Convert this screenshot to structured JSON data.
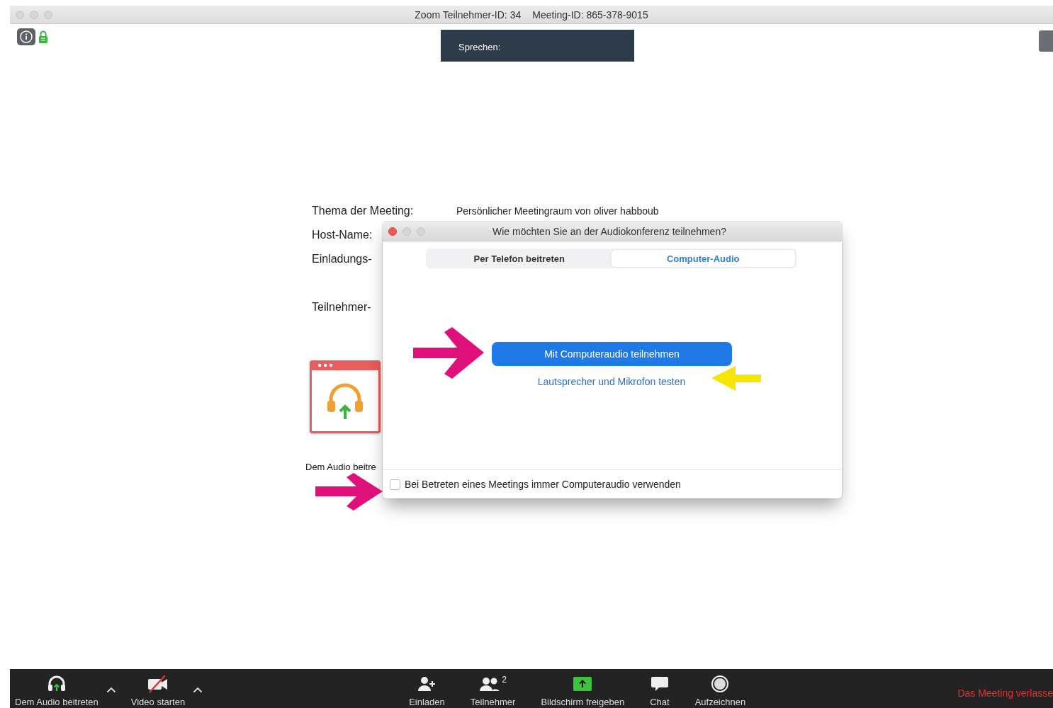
{
  "window": {
    "participant_id": "Zoom Teilnehmer-ID: 34",
    "meeting_id": "Meeting-ID: 865-378-9015"
  },
  "speaking_banner": {
    "label": "Sprechen:"
  },
  "meeting_info": [
    {
      "label": "Thema der Meeting:",
      "value": "Persönlicher Meetingraum von oliver habboub"
    },
    {
      "label": "Host-Name:"
    },
    {
      "label": "Einladungs-"
    },
    {
      "label": "Teilnehmer-"
    }
  ],
  "audio_tile": {
    "label": "Dem Audio beitre"
  },
  "dialog": {
    "title": "Wie möchten Sie an der Audiokonferenz teilnehmen?",
    "tabs": [
      {
        "label": "Per Telefon beitreten",
        "selected": false
      },
      {
        "label": "Computer-Audio",
        "selected": true
      }
    ],
    "primary_button": "Mit Computeraudio teilnehmen",
    "test_link": "Lautsprecher und Mikrofon testen",
    "checkbox": {
      "label": "Bei Betreten eines Meetings immer Computeraudio verwenden",
      "checked": false
    }
  },
  "toolbar": {
    "items": [
      {
        "kind": "audio",
        "label": "Dem Audio beitreten"
      },
      {
        "kind": "video",
        "label": "Video starten"
      },
      {
        "kind": "invite",
        "label": "Einladen"
      },
      {
        "kind": "participants",
        "label": "Teilnehmer",
        "count": "2"
      },
      {
        "kind": "share",
        "label": "Bildschirm freigeben"
      },
      {
        "kind": "chat",
        "label": "Chat"
      },
      {
        "kind": "record",
        "label": "Aufzeichnen"
      }
    ],
    "leave": "Das Meeting verlasse"
  }
}
